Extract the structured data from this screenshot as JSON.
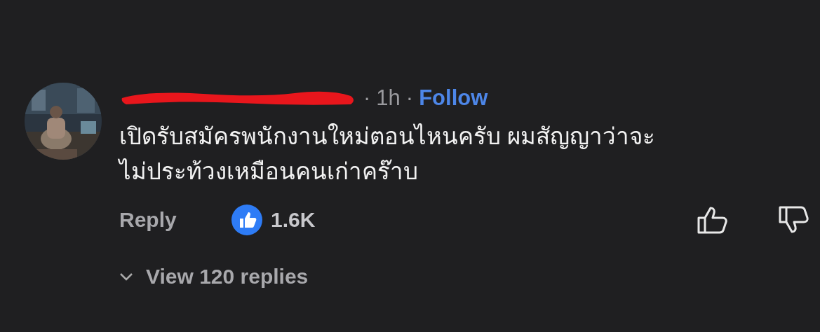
{
  "comment": {
    "author": {
      "redacted": true
    },
    "separators": [
      "·",
      "·"
    ],
    "time": "1h",
    "follow": "Follow",
    "text": "เปิดรับสมัครพนักงานใหม่ตอนไหนครับ ผมสัญญาว่าจะ\nไม่ประท้วงเหมือนคนเก่าคร๊าบ",
    "reply": "Reply",
    "likes": "1.6K",
    "liked": false,
    "disliked": false,
    "view_replies": "View 120 replies"
  }
}
